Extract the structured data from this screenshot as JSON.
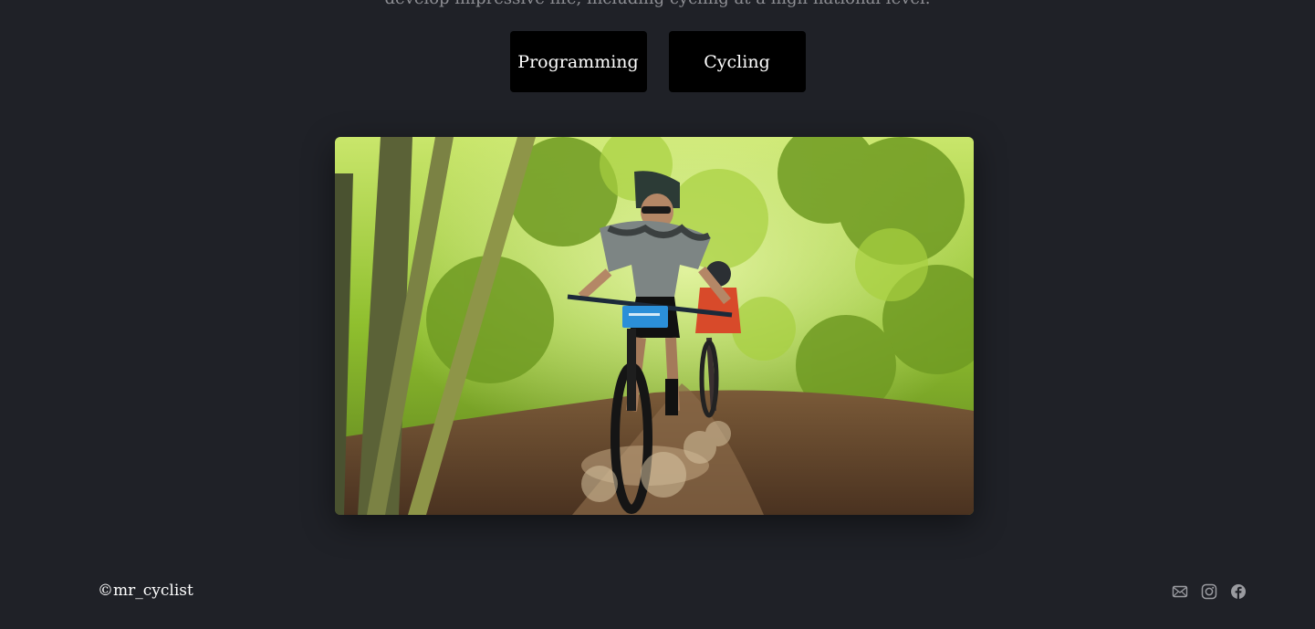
{
  "intro": {
    "text": "develop impressive life, including cycling at a high national level."
  },
  "tabs": [
    {
      "label": "Programming"
    },
    {
      "label": "Cycling"
    }
  ],
  "hero": {
    "alt": "Mountain biker racing down a forest trail"
  },
  "footer": {
    "copyright": "©mr_cyclist",
    "icons": [
      "mail-icon",
      "instagram-icon",
      "facebook-icon"
    ]
  },
  "colors": {
    "background": "#1f2127",
    "button": "#000000",
    "icon": "#9a9ba0",
    "text": "#ffffff"
  }
}
